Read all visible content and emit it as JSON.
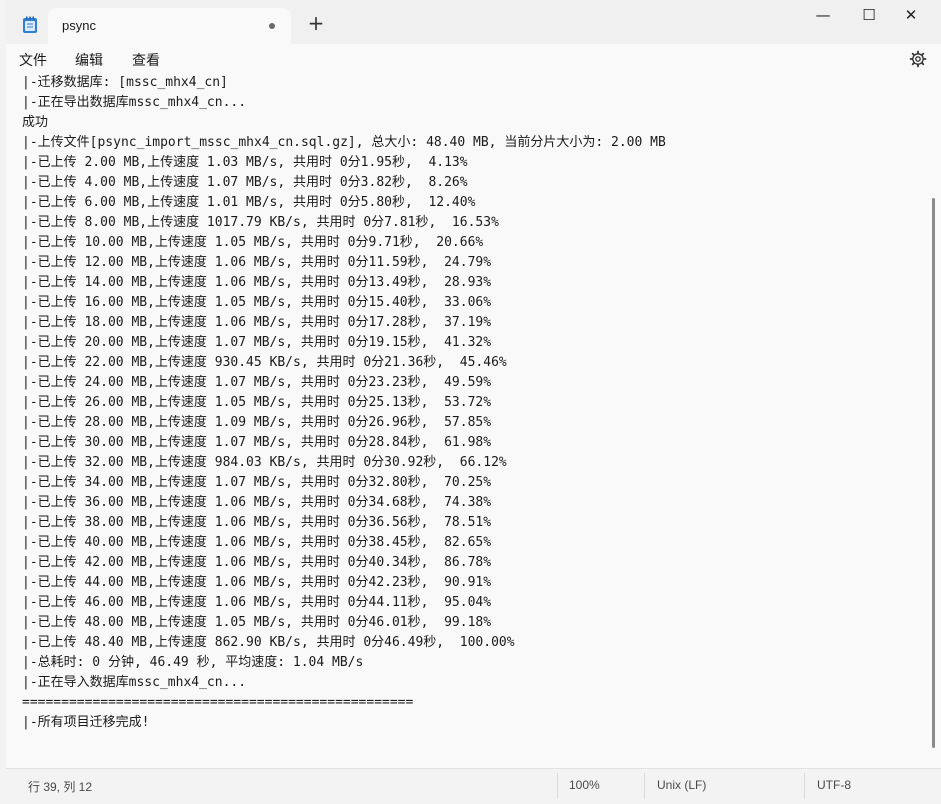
{
  "window": {
    "tab_title": "psync",
    "new_tab_label": "+",
    "minimize_label": "—",
    "maximize_label": "☐",
    "close_label": "✕"
  },
  "menu": {
    "file": "文件",
    "edit": "编辑",
    "view": "查看"
  },
  "editor": {
    "lines": [
      "|-迁移数据库: [mssc_mhx4_cn]",
      "|-正在导出数据库mssc_mhx4_cn...",
      "成功",
      "|-上传文件[psync_import_mssc_mhx4_cn.sql.gz], 总大小: 48.40 MB, 当前分片大小为: 2.00 MB",
      "|-已上传 2.00 MB,上传速度 1.03 MB/s, 共用时 0分1.95秒,  4.13%",
      "|-已上传 4.00 MB,上传速度 1.07 MB/s, 共用时 0分3.82秒,  8.26%",
      "|-已上传 6.00 MB,上传速度 1.01 MB/s, 共用时 0分5.80秒,  12.40%",
      "|-已上传 8.00 MB,上传速度 1017.79 KB/s, 共用时 0分7.81秒,  16.53%",
      "|-已上传 10.00 MB,上传速度 1.05 MB/s, 共用时 0分9.71秒,  20.66%",
      "|-已上传 12.00 MB,上传速度 1.06 MB/s, 共用时 0分11.59秒,  24.79%",
      "|-已上传 14.00 MB,上传速度 1.06 MB/s, 共用时 0分13.49秒,  28.93%",
      "|-已上传 16.00 MB,上传速度 1.05 MB/s, 共用时 0分15.40秒,  33.06%",
      "|-已上传 18.00 MB,上传速度 1.06 MB/s, 共用时 0分17.28秒,  37.19%",
      "|-已上传 20.00 MB,上传速度 1.07 MB/s, 共用时 0分19.15秒,  41.32%",
      "|-已上传 22.00 MB,上传速度 930.45 KB/s, 共用时 0分21.36秒,  45.46%",
      "|-已上传 24.00 MB,上传速度 1.07 MB/s, 共用时 0分23.23秒,  49.59%",
      "|-已上传 26.00 MB,上传速度 1.05 MB/s, 共用时 0分25.13秒,  53.72%",
      "|-已上传 28.00 MB,上传速度 1.09 MB/s, 共用时 0分26.96秒,  57.85%",
      "|-已上传 30.00 MB,上传速度 1.07 MB/s, 共用时 0分28.84秒,  61.98%",
      "|-已上传 32.00 MB,上传速度 984.03 KB/s, 共用时 0分30.92秒,  66.12%",
      "|-已上传 34.00 MB,上传速度 1.07 MB/s, 共用时 0分32.80秒,  70.25%",
      "|-已上传 36.00 MB,上传速度 1.06 MB/s, 共用时 0分34.68秒,  74.38%",
      "|-已上传 38.00 MB,上传速度 1.06 MB/s, 共用时 0分36.56秒,  78.51%",
      "|-已上传 40.00 MB,上传速度 1.06 MB/s, 共用时 0分38.45秒,  82.65%",
      "|-已上传 42.00 MB,上传速度 1.06 MB/s, 共用时 0分40.34秒,  86.78%",
      "|-已上传 44.00 MB,上传速度 1.06 MB/s, 共用时 0分42.23秒,  90.91%",
      "|-已上传 46.00 MB,上传速度 1.06 MB/s, 共用时 0分44.11秒,  95.04%",
      "|-已上传 48.00 MB,上传速度 1.05 MB/s, 共用时 0分46.01秒,  99.18%",
      "|-已上传 48.40 MB,上传速度 862.90 KB/s, 共用时 0分46.49秒,  100.00%",
      "|-总耗时: 0 分钟, 46.49 秒, 平均速度: 1.04 MB/s",
      "|-正在导入数据库mssc_mhx4_cn...",
      "==================================================",
      "|-所有项目迁移完成!"
    ]
  },
  "status": {
    "position": "行 39, 列 12",
    "zoom": "100%",
    "line_ending": "Unix (LF)",
    "encoding": "UTF-8"
  }
}
